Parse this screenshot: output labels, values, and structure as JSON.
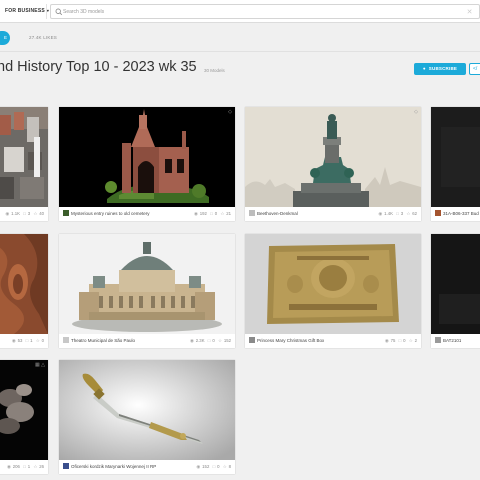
{
  "header": {
    "business_label": "FOR BUSINESS",
    "search_placeholder": "Search 3D models"
  },
  "subbar": {
    "pill_label": "E",
    "likes_label": "27.4K LIKES"
  },
  "collection": {
    "title": "nd History Top 10 - 2023 wk 35",
    "model_count": "30 Models",
    "subscribe_label": "SUBSCRIBE",
    "embed_label": "</"
  },
  "cards": [
    {
      "name": "",
      "views": "1.1K",
      "comments": "3",
      "likes": "40"
    },
    {
      "name": "Mysterious entry ruines to old cemetery",
      "views": "192",
      "comments": "0",
      "likes": "21"
    },
    {
      "name": "Beethoven-Denkmal",
      "views": "1.4K",
      "comments": "3",
      "likes": "62"
    },
    {
      "name": "31A-B06-337 Bud",
      "views": "",
      "comments": "",
      "likes": ""
    },
    {
      "name": "",
      "views": "53",
      "comments": "1",
      "likes": "0"
    },
    {
      "name": "Theatro Municipal de São Paulo",
      "views": "2.3K",
      "comments": "0",
      "likes": "152"
    },
    {
      "name": "Princess Mary Christmas Gift Box",
      "views": "75",
      "comments": "0",
      "likes": "2"
    },
    {
      "name": "BAT2101",
      "views": "",
      "comments": "",
      "likes": ""
    },
    {
      "name": "",
      "views": "206",
      "comments": "1",
      "likes": "26"
    },
    {
      "name": "Oficerski kordzik Marynarki Wojennej II RP",
      "views": "152",
      "comments": "0",
      "likes": "8"
    }
  ]
}
